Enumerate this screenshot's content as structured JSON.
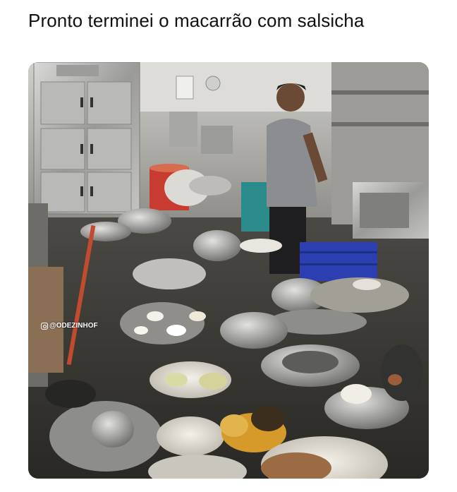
{
  "post": {
    "caption": "Pronto terminei o macarrão com salsicha",
    "watermark": "@ODEZINHOF",
    "watermark_icon": "instagram-icon"
  },
  "colors": {
    "background": "#ffffff",
    "caption_text": "#111111"
  }
}
